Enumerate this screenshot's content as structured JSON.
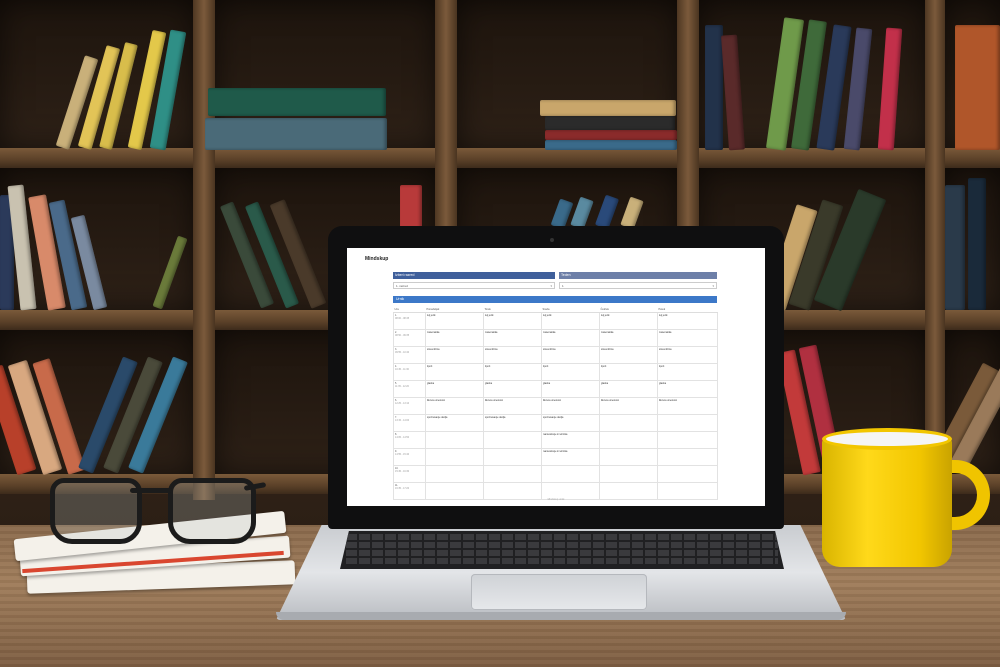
{
  "app": {
    "title": "Mindskup"
  },
  "selects": {
    "left_header": "Izberi razred",
    "left_value": "1. razred",
    "right_header": "Teden",
    "right_value": "1"
  },
  "timetable": {
    "section_title": "Urnik",
    "columns": [
      "Ura",
      "Ponedeljek",
      "Torek",
      "Sreda",
      "Četrtek",
      "Petek"
    ],
    "rows": [
      {
        "num": "1.",
        "time": "08:00 - 08:45",
        "cells": [
          "tuji jezik",
          "tuji jezik",
          "tuji jezik",
          "tuji jezik",
          "tuji jezik"
        ]
      },
      {
        "num": "2.",
        "time": "08:50 - 09:35",
        "cells": [
          "matematika",
          "matematika",
          "matematika",
          "matematika",
          "matematika"
        ]
      },
      {
        "num": "3.",
        "time": "09:55 - 10:40",
        "cells": [
          "slovenščina",
          "slovenščina",
          "slovenščina",
          "slovenščina",
          "slovenščina"
        ]
      },
      {
        "num": "4.",
        "time": "10:45 - 11:30",
        "cells": [
          "šport",
          "šport",
          "šport",
          "šport",
          "šport"
        ]
      },
      {
        "num": "5.",
        "time": "11:35 - 12:20",
        "cells": [
          "glasba",
          "glasba",
          "glasba",
          "glasba",
          "glasba"
        ]
      },
      {
        "num": "6.",
        "time": "12:25 - 13:10",
        "cells": [
          "likovna umetnost",
          "likovna umetnost",
          "likovna umetnost",
          "likovna umetnost",
          "likovna umetnost"
        ]
      },
      {
        "num": "7.",
        "time": "13:15 - 14:00",
        "cells": [
          "spoznavanje okolja",
          "spoznavanje okolja",
          "spoznavanje okolja",
          "",
          ""
        ]
      },
      {
        "num": "8.",
        "time": "14:05 - 14:50",
        "cells": [
          "",
          "",
          "naravoslovje in tehnika",
          "",
          ""
        ]
      },
      {
        "num": "9.",
        "time": "14:55 - 15:40",
        "cells": [
          "",
          "",
          "naravoslovje in tehnika",
          "",
          ""
        ]
      },
      {
        "num": "10.",
        "time": "15:45 - 16:30",
        "cells": [
          "",
          "",
          "",
          "",
          ""
        ]
      },
      {
        "num": "11.",
        "time": "16:35 - 17:20",
        "cells": [
          "",
          "",
          "",
          "",
          ""
        ]
      }
    ]
  },
  "footer": {
    "text": "Mindskup urnik"
  },
  "colors": {
    "select_header_left": "#3f5f9b",
    "select_header_right": "#6d7fa8",
    "section_bar": "#3c78c8",
    "mug_yellow": "#ffd91a"
  }
}
